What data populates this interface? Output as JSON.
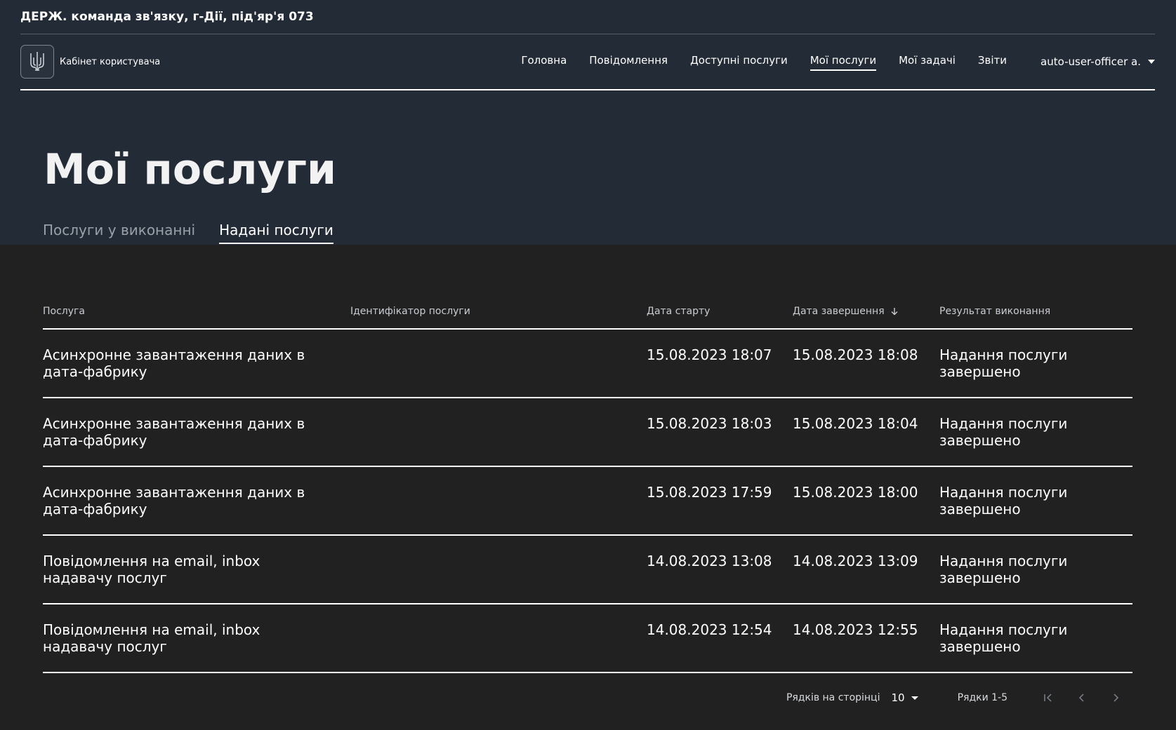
{
  "org": {
    "name": "ДЕРЖ. команда зв'язку, г-Дії, під'яр'я 073"
  },
  "header": {
    "cabinet": "Кабінет користувача",
    "nav": [
      "Головна",
      "Повідомлення",
      "Доступні послуги",
      "Мої послуги",
      "Мої задачі",
      "Звіти"
    ],
    "active_nav": "Мої послуги",
    "user": "auto-user-officer a."
  },
  "page": {
    "title": "Мої послуги",
    "tabs": [
      "Послуги у виконанні",
      "Надані послуги"
    ],
    "active_tab": "Надані послуги"
  },
  "table": {
    "columns": [
      "Послуга",
      "Ідентифікатор послуги",
      "Дата старту",
      "Дата завершення",
      "Результат виконання"
    ],
    "sorted_column": "Дата завершення",
    "rows": [
      {
        "service": "Асинхронне завантаження даних в дата-фабрику",
        "id": "",
        "start": "15.08.2023 18:07",
        "end": "15.08.2023 18:08",
        "result": "Надання послуги завершено"
      },
      {
        "service": "Асинхронне завантаження даних в дата-фабрику",
        "id": "",
        "start": "15.08.2023 18:03",
        "end": "15.08.2023 18:04",
        "result": "Надання послуги завершено"
      },
      {
        "service": "Асинхронне завантаження даних в дата-фабрику",
        "id": "",
        "start": "15.08.2023 17:59",
        "end": "15.08.2023 18:00",
        "result": "Надання послуги завершено"
      },
      {
        "service": "Повідомлення на email, inbox надавачу послуг",
        "id": "",
        "start": "14.08.2023 13:08",
        "end": "14.08.2023 13:09",
        "result": "Надання послуги завершено"
      },
      {
        "service": "Повідомлення на email, inbox надавачу послуг",
        "id": "",
        "start": "14.08.2023 12:54",
        "end": "14.08.2023 12:55",
        "result": "Надання послуги завершено"
      }
    ]
  },
  "pagination": {
    "rows_per_page_label": "Рядків на сторінці",
    "rows_per_page": "10",
    "range": "Рядки 1-5"
  },
  "icons": {
    "logo": "trident-icon",
    "sort": "arrow-down-icon",
    "first": "first-page-icon",
    "prev": "chevron-left-icon",
    "next": "chevron-right-icon"
  },
  "colors": {
    "header_bg": "#232b36",
    "body_bg": "#212121",
    "text": "#ffffff",
    "muted": "#9aa0a8"
  }
}
